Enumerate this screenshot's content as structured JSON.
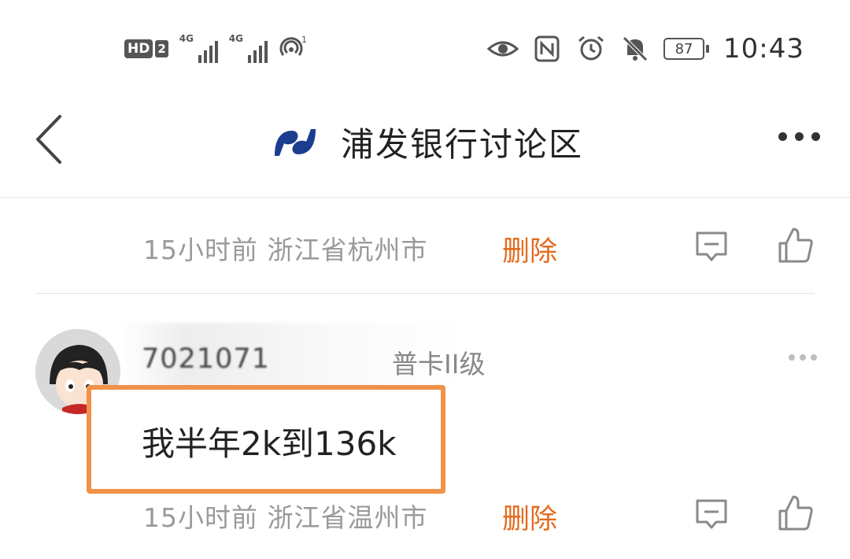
{
  "status_bar": {
    "hd_label": "HD",
    "sim_label": "2",
    "signal1_label": "4G",
    "signal2_label": "4G",
    "hotspot_count": "1",
    "battery_level": "87",
    "time": "10:43",
    "icons": [
      "hd-icon",
      "signal-icon",
      "hotspot-icon",
      "eye-icon",
      "nfc-icon",
      "alarm-icon",
      "mute-icon",
      "battery-icon"
    ]
  },
  "nav": {
    "back_icon": "chevron-left-icon",
    "logo_icon": "spdb-logo-icon",
    "title": "浦发银行讨论区",
    "more_icon": "more-dots-icon"
  },
  "comments": [
    {
      "time_location": "15小时前  浙江省杭州市",
      "delete_label": "删除"
    },
    {
      "username": "7021071",
      "level": "普卡II级",
      "text": "我半年2k到136k",
      "time_location": "15小时前  浙江省温州市",
      "delete_label": "删除"
    }
  ],
  "colors": {
    "accent": "#e36a1c",
    "highlight_border": "#f0924a",
    "meta_text": "#9a9a9a",
    "logo": "#1a3d8f"
  }
}
